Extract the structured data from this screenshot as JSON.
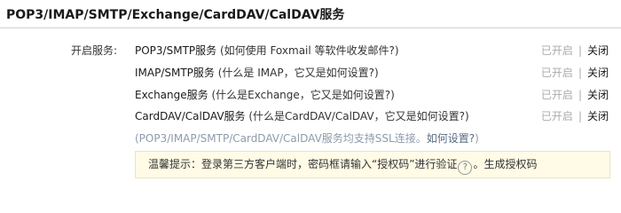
{
  "title": "POP3/IMAP/SMTP/Exchange/CardDAV/CalDAV服务",
  "label": "开启服务:",
  "services": [
    {
      "name": "POP3/SMTP服务",
      "help_prefix": " (如何使用 Foxmail 等软件收发邮件?)",
      "status": "已开启",
      "sep": "|",
      "action": "关闭"
    },
    {
      "name": "IMAP/SMTP服务",
      "help_prefix": " (什么是 IMAP，它又是如何设置?)",
      "status": "已开启",
      "sep": "|",
      "action": "关闭"
    },
    {
      "name": "Exchange服务",
      "help_prefix": " (什么是Exchange，它又是如何设置?)",
      "status": "已开启",
      "sep": "|",
      "action": "关闭"
    },
    {
      "name": "CardDAV/CalDAV服务",
      "help_prefix": " (什么是CardDAV/CalDAV，它又是如何设置?)",
      "status": "已开启",
      "sep": "|",
      "action": "关闭"
    }
  ],
  "ssl_note": {
    "text": "(POP3/IMAP/SMTP/CardDAV/CalDAV服务均支持SSL连接。",
    "link": "如何设置?",
    "suffix": ")"
  },
  "tip": {
    "text": "温馨提示：登录第三方客户端时，密码框请输入“授权码”进行验证",
    "help_icon": "?",
    "dot": "。",
    "link": "生成授权码"
  }
}
